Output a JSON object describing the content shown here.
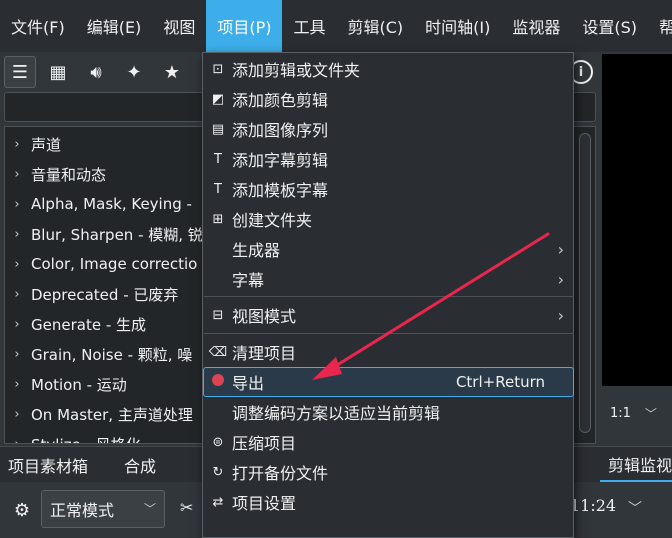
{
  "menubar": {
    "items": [
      "文件(F)",
      "编辑(E)",
      "视图",
      "项目(P)",
      "工具",
      "剪辑(C)",
      "时间轴(I)",
      "监视器",
      "设置(S)",
      "帮助"
    ],
    "active_index": 3
  },
  "effects_panel": {
    "tree_items": [
      "声道",
      "音量和动态",
      "Alpha, Mask, Keying - ",
      "Blur, Sharpen - 模糊, 锐",
      "Color, Image correctio",
      "Deprecated - 已废弃",
      "Generate - 生成",
      "Grain, Noise - 颗粒, 噪",
      "Motion - 运动",
      "On Master, 主声道处理",
      "Stylize - 风格化"
    ]
  },
  "monitor": {
    "zoom_label": "1:1"
  },
  "bottom_tabs": {
    "tabs": [
      "项目素材箱",
      "合成"
    ],
    "right_tab": "剪辑监视"
  },
  "timeline_toolbar": {
    "mode_label": "正常模式",
    "timecode": "11:24"
  },
  "project_menu": {
    "items": [
      {
        "icon": "add-clip-icon",
        "label": "添加剪辑或文件夹"
      },
      {
        "icon": "color-clip-icon",
        "label": "添加颜色剪辑"
      },
      {
        "icon": "image-sequence-icon",
        "label": "添加图像序列"
      },
      {
        "icon": "title-clip-icon",
        "label": "添加字幕剪辑"
      },
      {
        "icon": "template-title-icon",
        "label": "添加模板字幕"
      },
      {
        "icon": "folder-icon",
        "label": "创建文件夹"
      },
      {
        "icon": "",
        "label": "生成器",
        "submenu": true
      },
      {
        "icon": "",
        "label": "字幕",
        "submenu": true
      },
      {
        "icon": "view-mode-icon",
        "label": "视图模式",
        "submenu": true
      },
      {
        "icon": "clean-icon",
        "label": "清理项目"
      },
      {
        "icon": "record-icon",
        "label": "导出",
        "shortcut": "Ctrl+Return",
        "highlighted": true
      },
      {
        "icon": "",
        "label": "调整编码方案以适应当前剪辑"
      },
      {
        "icon": "archive-icon",
        "label": "压缩项目"
      },
      {
        "icon": "backup-icon",
        "label": "打开备份文件"
      },
      {
        "icon": "settings-icon",
        "label": "项目设置"
      }
    ]
  },
  "colors": {
    "accent": "#3daee9",
    "annotation_arrow": "#e8264e",
    "record_dot": "#da4453"
  }
}
